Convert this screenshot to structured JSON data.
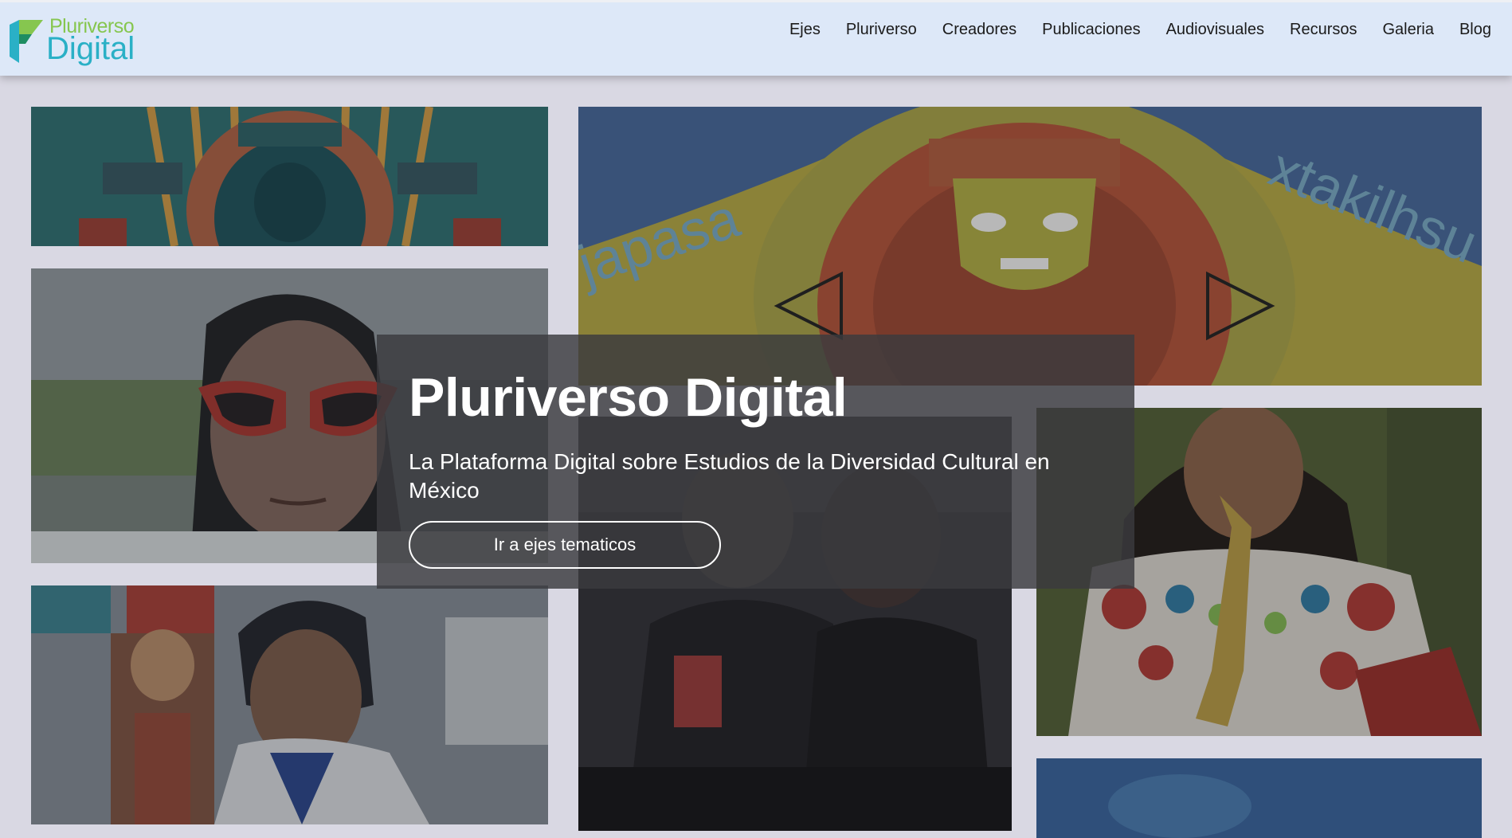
{
  "brand": {
    "logo_top": "Pluriverso",
    "logo_bottom": "Digital",
    "colors": {
      "green": "#86c64f",
      "teal": "#2ab0c6"
    }
  },
  "nav": {
    "items": [
      "Ejes",
      "Pluriverso",
      "Creadores",
      "Publicaciones",
      "Audiovisuales",
      "Recursos",
      "Galeria",
      "Blog"
    ]
  },
  "hero": {
    "title": "Pluriverso Digital",
    "subtitle": "La Plataforma Digital sobre Estudios de la Diversidad Cultural en México",
    "button_label": "Ir a ejes tematicos"
  },
  "mosaic": {
    "mural_words": [
      "japasa",
      "xtakilhsu"
    ]
  },
  "colors": {
    "header_bg": "#dde8f8",
    "page_bg": "#d9d8e3",
    "overlay": "#3a3a3e"
  }
}
